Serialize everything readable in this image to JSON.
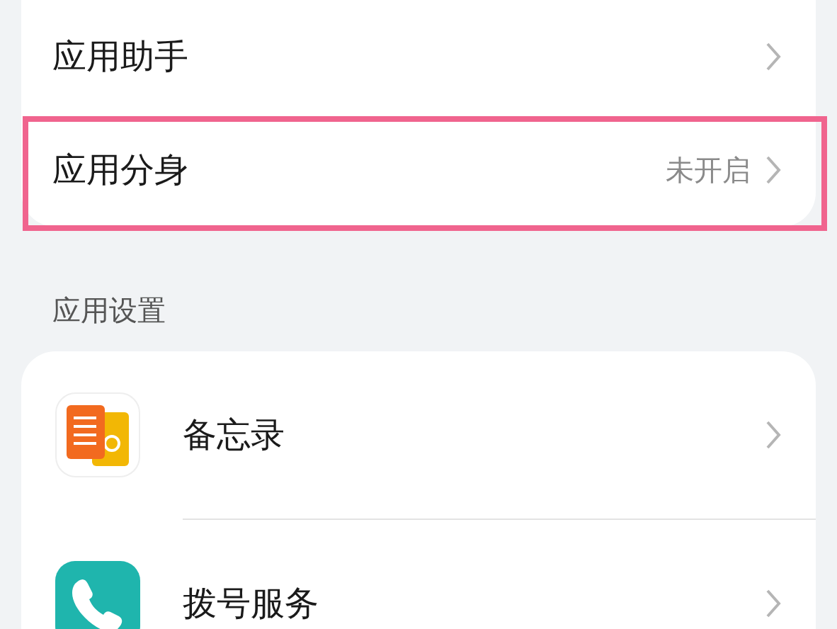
{
  "top_items": [
    {
      "label": "应用助手",
      "highlighted": false
    },
    {
      "label": "应用分身",
      "value": "未开启",
      "highlighted": true
    }
  ],
  "section_title": "应用设置",
  "apps": [
    {
      "kind": "notes",
      "label": "备忘录"
    },
    {
      "kind": "phone",
      "label": "拨号服务"
    }
  ]
}
